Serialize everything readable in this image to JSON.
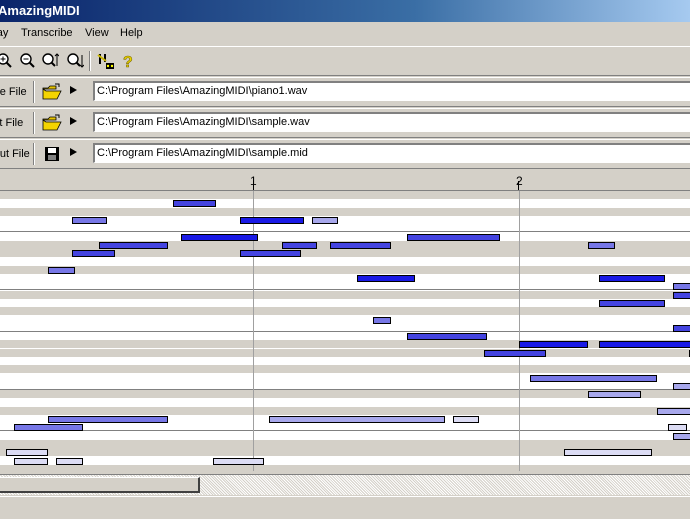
{
  "window": {
    "title": "AmazingMIDI"
  },
  "menu": [
    "Play",
    "Transcribe",
    "View",
    "Help"
  ],
  "toolbar": {
    "icons": [
      "zoom-in-icon",
      "zoom-out-icon",
      "zoom-fit-icon",
      "zoom-reset-icon",
      "tuning-icon",
      "help-icon"
    ]
  },
  "files": [
    {
      "label": "Tone File",
      "icon": "open-folder-icon",
      "value": "C:\\Program Files\\AmazingMIDI\\piano1.wav"
    },
    {
      "label": "Input File",
      "icon": "open-folder-icon",
      "value": "C:\\Program Files\\AmazingMIDI\\sample.wav"
    },
    {
      "label": "Output File",
      "icon": "save-disk-icon",
      "value": "C:\\Program Files\\AmazingMIDI\\sample.mid"
    }
  ],
  "ruler": {
    "marks": [
      "1",
      "2"
    ]
  },
  "colors": {
    "note_strong": "#1a1ae6",
    "note_medium": "#4444e0",
    "note_light": "#7777e6",
    "note_pale": "#a8a8ec",
    "note_faint": "#dcdcf4"
  },
  "notes": [
    {
      "pitch": 2,
      "start": 0.7,
      "end": 0.86,
      "v": "medium"
    },
    {
      "pitch": 4,
      "start": 0.32,
      "end": 0.45,
      "v": "light"
    },
    {
      "pitch": 4,
      "start": 0.95,
      "end": 1.19,
      "v": "strong"
    },
    {
      "pitch": 4,
      "start": 1.22,
      "end": 1.32,
      "v": "pale"
    },
    {
      "pitch": 6,
      "start": 0.73,
      "end": 1.02,
      "v": "strong"
    },
    {
      "pitch": 6,
      "start": 1.58,
      "end": 1.93,
      "v": "medium"
    },
    {
      "pitch": 7,
      "start": 0.42,
      "end": 0.68,
      "v": "medium"
    },
    {
      "pitch": 7,
      "start": 1.11,
      "end": 1.24,
      "v": "medium"
    },
    {
      "pitch": 7,
      "start": 1.29,
      "end": 1.52,
      "v": "medium"
    },
    {
      "pitch": 7,
      "start": 2.26,
      "end": 2.36,
      "v": "light"
    },
    {
      "pitch": 8,
      "start": 0.32,
      "end": 0.48,
      "v": "medium"
    },
    {
      "pitch": 8,
      "start": 0.95,
      "end": 1.18,
      "v": "medium"
    },
    {
      "pitch": 10,
      "start": 0.23,
      "end": 0.33,
      "v": "light"
    },
    {
      "pitch": 11,
      "start": 1.39,
      "end": 1.61,
      "v": "strong"
    },
    {
      "pitch": 11,
      "start": 2.3,
      "end": 2.55,
      "v": "strong"
    },
    {
      "pitch": 12,
      "start": 2.58,
      "end": 2.7,
      "v": "light"
    },
    {
      "pitch": 13,
      "start": 2.58,
      "end": 2.7,
      "v": "medium"
    },
    {
      "pitch": 14,
      "start": 2.3,
      "end": 2.55,
      "v": "medium"
    },
    {
      "pitch": 16,
      "start": 1.45,
      "end": 1.52,
      "v": "light"
    },
    {
      "pitch": 17,
      "start": 2.58,
      "end": 2.7,
      "v": "medium"
    },
    {
      "pitch": 18,
      "start": 1.58,
      "end": 1.88,
      "v": "medium"
    },
    {
      "pitch": 19,
      "start": 2.0,
      "end": 2.26,
      "v": "strong"
    },
    {
      "pitch": 19,
      "start": 2.3,
      "end": 2.7,
      "v": "strong"
    },
    {
      "pitch": 20,
      "start": 1.87,
      "end": 2.1,
      "v": "medium"
    },
    {
      "pitch": 20,
      "start": 2.64,
      "end": 2.7,
      "v": "light"
    },
    {
      "pitch": 23,
      "start": 2.04,
      "end": 2.52,
      "v": "light"
    },
    {
      "pitch": 24,
      "start": 2.58,
      "end": 2.7,
      "v": "pale"
    },
    {
      "pitch": 25,
      "start": 2.26,
      "end": 2.46,
      "v": "pale"
    },
    {
      "pitch": 27,
      "start": 2.52,
      "end": 2.7,
      "v": "pale"
    },
    {
      "pitch": 28,
      "start": 0.23,
      "end": 0.68,
      "v": "light"
    },
    {
      "pitch": 28,
      "start": 1.06,
      "end": 1.72,
      "v": "pale"
    },
    {
      "pitch": 28,
      "start": 1.75,
      "end": 1.85,
      "v": "faint"
    },
    {
      "pitch": 29,
      "start": 0.1,
      "end": 0.36,
      "v": "light"
    },
    {
      "pitch": 29,
      "start": 2.56,
      "end": 2.63,
      "v": "faint"
    },
    {
      "pitch": 30,
      "start": 2.58,
      "end": 2.7,
      "v": "pale"
    },
    {
      "pitch": 32,
      "start": 0.07,
      "end": 0.23,
      "v": "faint"
    },
    {
      "pitch": 32,
      "start": 2.17,
      "end": 2.5,
      "v": "faint"
    },
    {
      "pitch": 33,
      "start": 0.1,
      "end": 0.23,
      "v": "faint"
    },
    {
      "pitch": 33,
      "start": 0.26,
      "end": 0.36,
      "v": "faint"
    },
    {
      "pitch": 33,
      "start": 0.85,
      "end": 1.04,
      "v": "faint"
    },
    {
      "pitch": 35,
      "start": 1.94,
      "end": 2.62,
      "v": "medium"
    }
  ]
}
